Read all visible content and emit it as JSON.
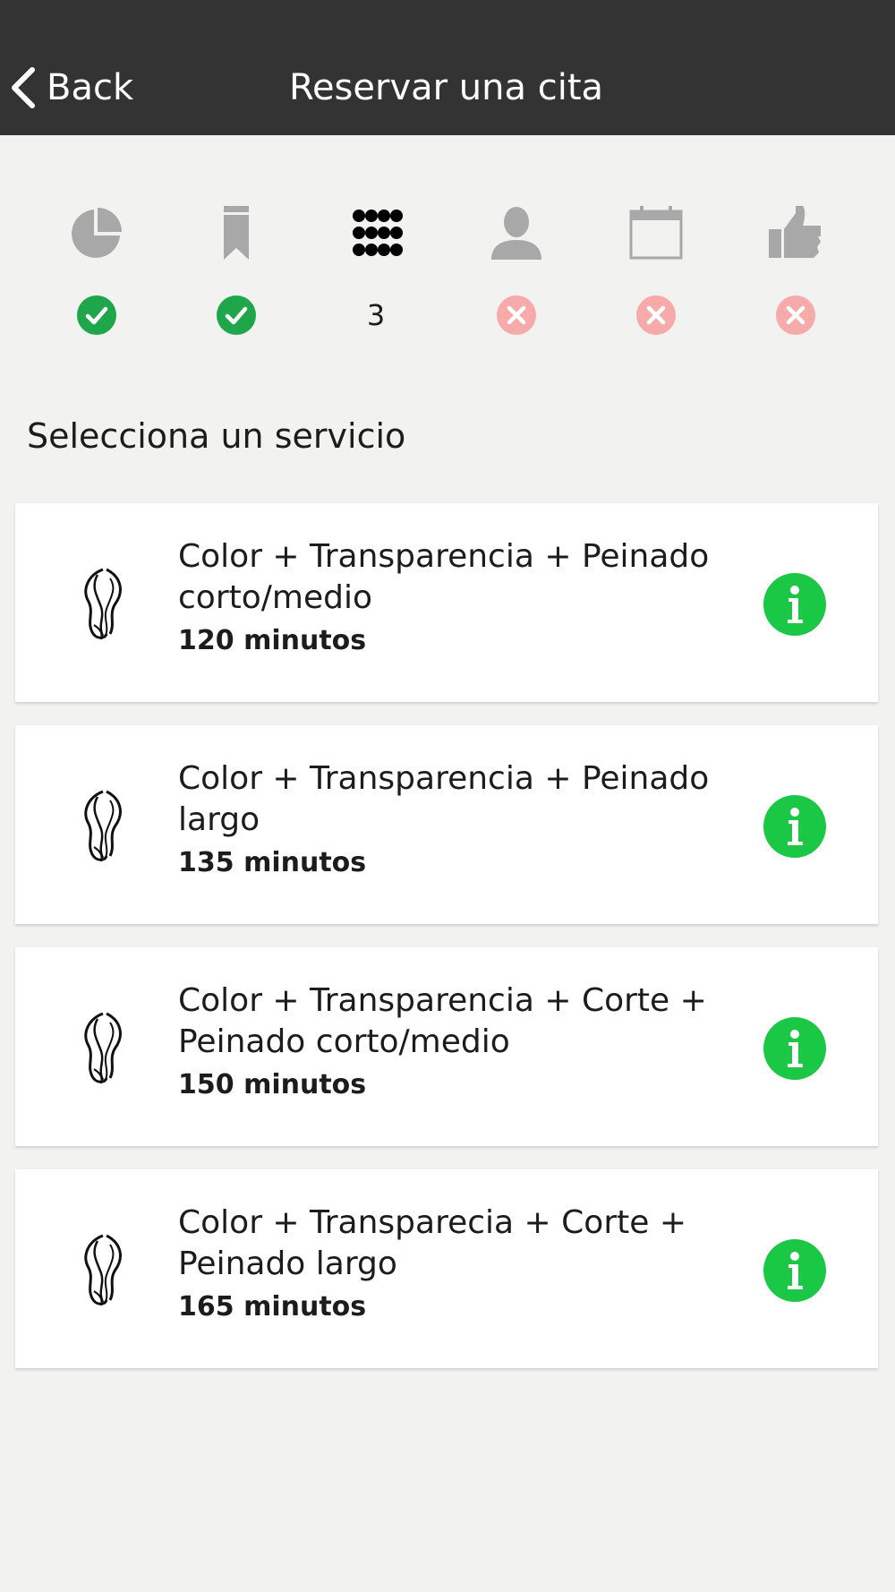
{
  "navbar": {
    "back_label": "Back",
    "title": "Reservar una cita",
    "back_icon": "chevron-left-icon"
  },
  "steps": [
    {
      "icon": "pie-chart-icon",
      "status": "done"
    },
    {
      "icon": "bookmark-icon",
      "status": "done"
    },
    {
      "icon": "grid-dots-icon",
      "status": "current",
      "number": "3"
    },
    {
      "icon": "user-icon",
      "status": "pending"
    },
    {
      "icon": "calendar-icon",
      "status": "pending"
    },
    {
      "icon": "thumbs-up-icon",
      "status": "pending"
    }
  ],
  "section_title": "Selecciona un servicio",
  "services": [
    {
      "name_line1": "Color + Transparencia + Peinado",
      "name_line2": "corto/medio",
      "duration": "120 minutos"
    },
    {
      "name_line1": "Color + Transparencia + Peinado",
      "name_line2": "largo",
      "duration": "135 minutos"
    },
    {
      "name_line1": "Color + Transparencia + Corte +",
      "name_line2": "Peinado corto/medio",
      "duration": "150 minutos"
    },
    {
      "name_line1": "Color + Transparecia + Corte +",
      "name_line2": "Peinado largo",
      "duration": "165 minutos"
    }
  ],
  "colors": {
    "navbar_bg": "#333333",
    "background": "#f2f2f1",
    "done_green": "#1fa64a",
    "pending_red": "#f7aaaa",
    "info_green": "#1bc845",
    "inactive_icon": "#a8a8a8"
  }
}
